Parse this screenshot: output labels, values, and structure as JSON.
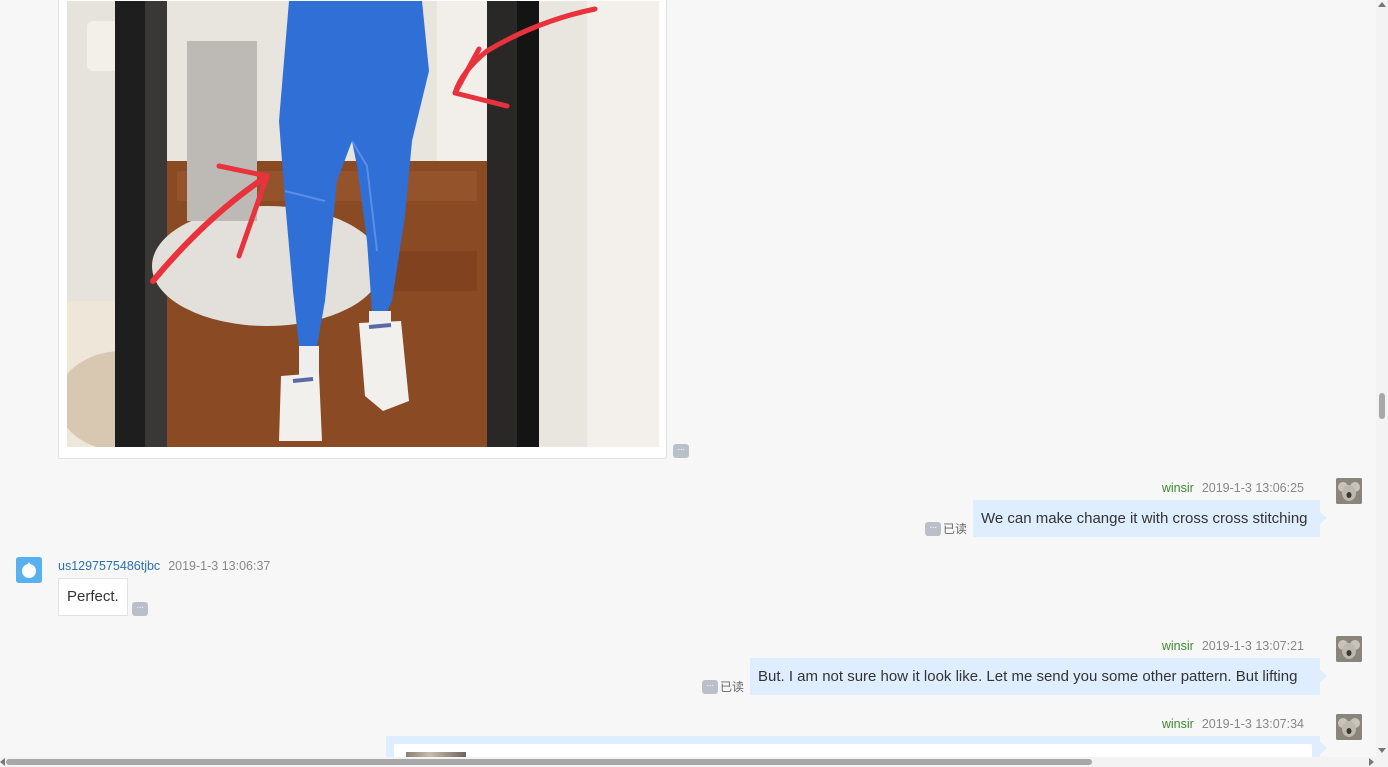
{
  "ui": {
    "more_label": "···",
    "read_label": "已读"
  },
  "messages": [
    {
      "sender": "winsir",
      "time": "2019-1-3 13:06:25",
      "text": "We can make change it with cross cross stitching"
    },
    {
      "sender": "us1297575486tjbc",
      "time": "2019-1-3 13:06:37",
      "text": "Perfect."
    },
    {
      "sender": "winsir",
      "time": "2019-1-3 13:07:21",
      "text": "But. I am not sure how it look like. Let me send you some other pattern. But lifting"
    },
    {
      "sender": "winsir",
      "time": "2019-1-3 13:07:34"
    }
  ],
  "colors": {
    "my_bubble": "#dfeefe",
    "my_name": "#3d8a2e",
    "their_name": "#2a6fb0"
  }
}
